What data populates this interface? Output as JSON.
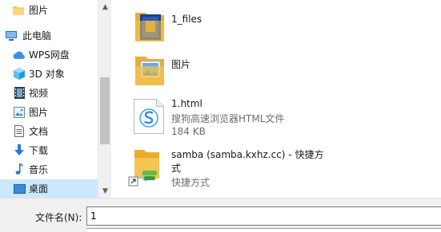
{
  "nav": {
    "items": [
      {
        "label": "图片",
        "icon": "folder-icon"
      },
      {
        "label": "此电脑",
        "icon": "computer-icon"
      },
      {
        "label": "WPS网盘",
        "icon": "cloud-icon"
      },
      {
        "label": "3D 对象",
        "icon": "3d-objects-icon"
      },
      {
        "label": "视频",
        "icon": "video-icon"
      },
      {
        "label": "图片",
        "icon": "pictures-icon"
      },
      {
        "label": "文档",
        "icon": "documents-icon"
      },
      {
        "label": "下载",
        "icon": "download-icon"
      },
      {
        "label": "音乐",
        "icon": "music-icon"
      },
      {
        "label": "桌面",
        "icon": "desktop-icon",
        "selected": true
      }
    ]
  },
  "files": [
    {
      "name": "1_files",
      "icon": "folder-icon"
    },
    {
      "name": "图片",
      "icon": "folder-icon"
    },
    {
      "name": "1.html",
      "type": "搜狗高速浏览器HTML文件",
      "size": "184 KB",
      "icon": "html-file-icon"
    },
    {
      "name_line1": "samba (samba.kxhz.cc) - 快捷方",
      "name_line2": "式",
      "type": "快捷方式",
      "icon": "shortcut-folder-icon"
    }
  ],
  "footer": {
    "filename_label": "文件名(N):",
    "filename_value": "1"
  },
  "colors": {
    "selection": "#cce8ff",
    "folder": "#f4c454",
    "scrollbar_thumb": "#c2c2c2"
  }
}
